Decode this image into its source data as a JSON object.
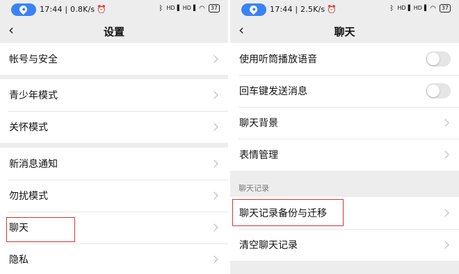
{
  "left": {
    "status": {
      "time_speed": "17:44 | 0.8K/s",
      "network_1": "HD",
      "network_2": "HD",
      "battery": "37"
    },
    "title": "设置",
    "groups": [
      {
        "items": [
          {
            "label": "帐号与安全"
          }
        ]
      },
      {
        "items": [
          {
            "label": "青少年模式"
          },
          {
            "label": "关怀模式"
          }
        ]
      },
      {
        "items": [
          {
            "label": "新消息通知"
          },
          {
            "label": "勿扰模式"
          },
          {
            "label": "聊天"
          },
          {
            "label": "隐私"
          }
        ]
      }
    ]
  },
  "right": {
    "status": {
      "time_speed": "17:44 | 2.5K/s",
      "network_1": "HD",
      "network_2": "HD",
      "battery": "37"
    },
    "title": "聊天",
    "group1": [
      {
        "label": "使用听筒播放语音",
        "control": "toggle",
        "on": false
      },
      {
        "label": "回车键发送消息",
        "control": "toggle",
        "on": false
      },
      {
        "label": "聊天背景",
        "control": "chevron"
      },
      {
        "label": "表情管理",
        "control": "chevron"
      }
    ],
    "section_title": "聊天记录",
    "group2": [
      {
        "label": "聊天记录备份与迁移"
      },
      {
        "label": "清空聊天记录"
      }
    ]
  },
  "colors": {
    "accent_blue": "#3a82f7",
    "highlight_red": "#d0353a"
  }
}
